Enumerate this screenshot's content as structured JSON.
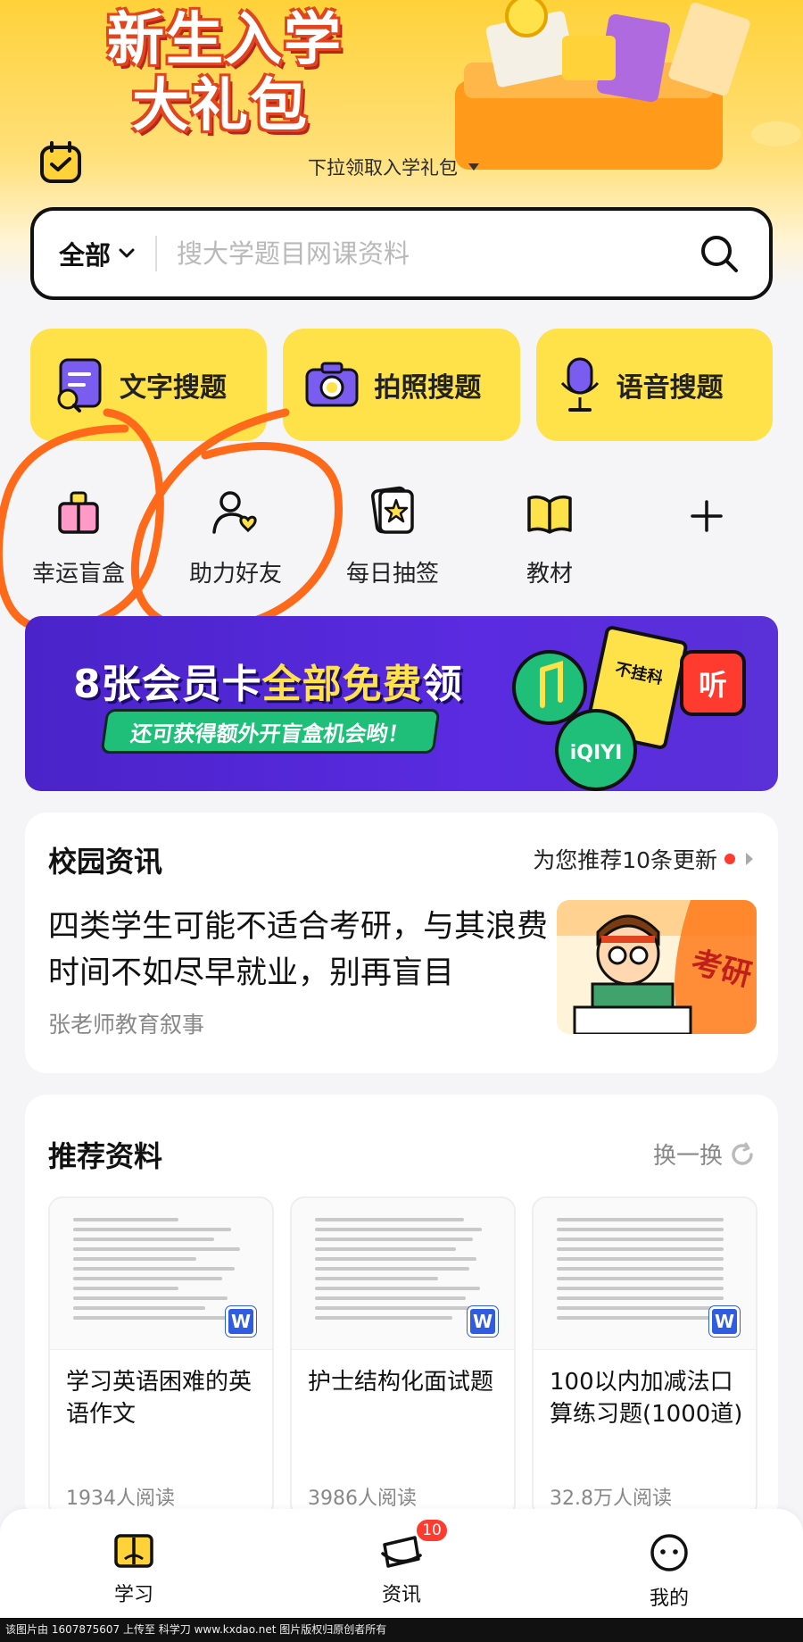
{
  "hero": {
    "title_line1": "新生入学",
    "title_line2": "大礼包",
    "pull_hint": "下拉领取入学礼包"
  },
  "search": {
    "scope": "全部",
    "placeholder": "搜大学题目网课资料"
  },
  "quick_search": [
    {
      "label": "文字搜题",
      "icon": "text-search-icon"
    },
    {
      "label": "拍照搜题",
      "icon": "camera-icon"
    },
    {
      "label": "语音搜题",
      "icon": "microphone-icon"
    }
  ],
  "tools": [
    {
      "label": "幸运盲盒",
      "icon": "gift-box-icon"
    },
    {
      "label": "助力好友",
      "icon": "friend-heart-icon"
    },
    {
      "label": "每日抽签",
      "icon": "star-card-icon"
    },
    {
      "label": "教材",
      "icon": "book-icon"
    },
    {
      "label": "",
      "icon": "plus-icon"
    }
  ],
  "promo": {
    "head_pre": "8张会员卡",
    "head_highlight": "全部免费",
    "head_post": "领",
    "sub": "还可获得额外开盲盒机会哟！",
    "logos": [
      "不挂科",
      "听",
      "iQIYI"
    ]
  },
  "news": {
    "section_title": "校园资讯",
    "recommend_text": "为您推荐10条更新",
    "headline": "四类学生可能不适合考研，与其浪费时间不如尽早就业，别再盲目",
    "author": "张老师教育叙事",
    "thumb_text": "考研"
  },
  "recommended": {
    "section_title": "推荐资料",
    "swap_label": "换一换",
    "docs": [
      {
        "title": "学习英语困难的英语作文",
        "reads": "1934人阅读",
        "badge": "W"
      },
      {
        "title": "护士结构化面试题",
        "reads": "3986人阅读",
        "badge": "W"
      },
      {
        "title": "100以内加减法口算练习题(1000道)",
        "reads": "32.8万人阅读",
        "badge": "W"
      }
    ]
  },
  "tabbar": {
    "tabs": [
      {
        "label": "学习",
        "icon": "book-open-icon"
      },
      {
        "label": "资讯",
        "icon": "news-icon",
        "badge": "10"
      },
      {
        "label": "我的",
        "icon": "smile-face-icon"
      }
    ]
  },
  "footer_text": "该图片由 1607875607 上传至 科学刀 www.kxdao.net 图片版权归原创者所有",
  "colors": {
    "accent_yellow": "#ffe14a",
    "promo_purple": "#5a2be0",
    "badge_red": "#ff3b30",
    "scribble_orange": "#ff6a1a"
  }
}
